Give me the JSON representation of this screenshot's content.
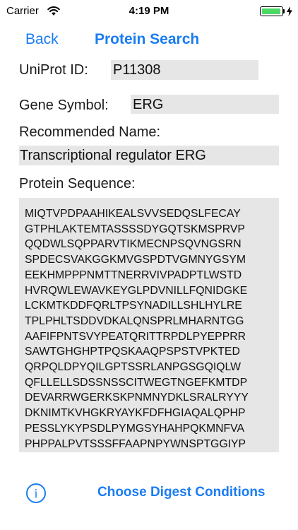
{
  "status_bar": {
    "carrier": "Carrier",
    "time": "4:19 PM",
    "battery_level": 0.95,
    "battery_color": "#4cd964"
  },
  "nav": {
    "back_label": "Back",
    "title": "Protein Search",
    "accent_color": "#1a7cf2"
  },
  "form": {
    "uniprot_label": "UniProt ID:",
    "uniprot_value": "P11308",
    "gene_label": "Gene Symbol:",
    "gene_value": "ERG",
    "recommended_label": "Recommended Name:",
    "recommended_value": "Transcriptional regulator ERG",
    "sequence_label": "Protein Sequence:"
  },
  "sequence_lines": [
    "MIQTVPDPAAHIKEALSVVSEDQSLFECAY",
    "GTPHLAKTEMTASSSSDYGQTSKMSPRVP",
    "QQDWLSQPPARVTIKMECNPSQVNGSRN",
    "SPDECSVAKGGKMVGSPDTVGMNYGSYM",
    "EEKHMPPPNMTTNERRVIVPADPTLWSTD",
    "HVRQWLEWAVKEYGLPDVNILLFQNIDGKE",
    "LCKMTKDDFQRLTPSYNADILLSHLHYLRE",
    "TPLPHLTSDDVDKALQNSPRLMHARNTGG",
    "AAFIFPNTSVYPEATQRITTRPDLPYEPPRR",
    "SAWTGHGHPTPQSKAAQPSPSTVPKTED",
    "QRPQLDPYQILGPTSSRLANPGSGQIQLW",
    "QFLLELLSDSSNSSCITWEGTNGEFKMTDP",
    "DEVARRWGERKSKPNMNYDKLSRALRYYY",
    "DKNIMTKVHGKRYAYKFDFHGIAQALQPHP",
    "PESSLYKYPSDLPYMGSYHAHPQKMNFVA",
    "PHPPALPVTSSSFFAAPNPYWNSPTGGIYP"
  ],
  "footer": {
    "info_glyph": "i",
    "digest_label": "Choose Digest Conditions"
  }
}
